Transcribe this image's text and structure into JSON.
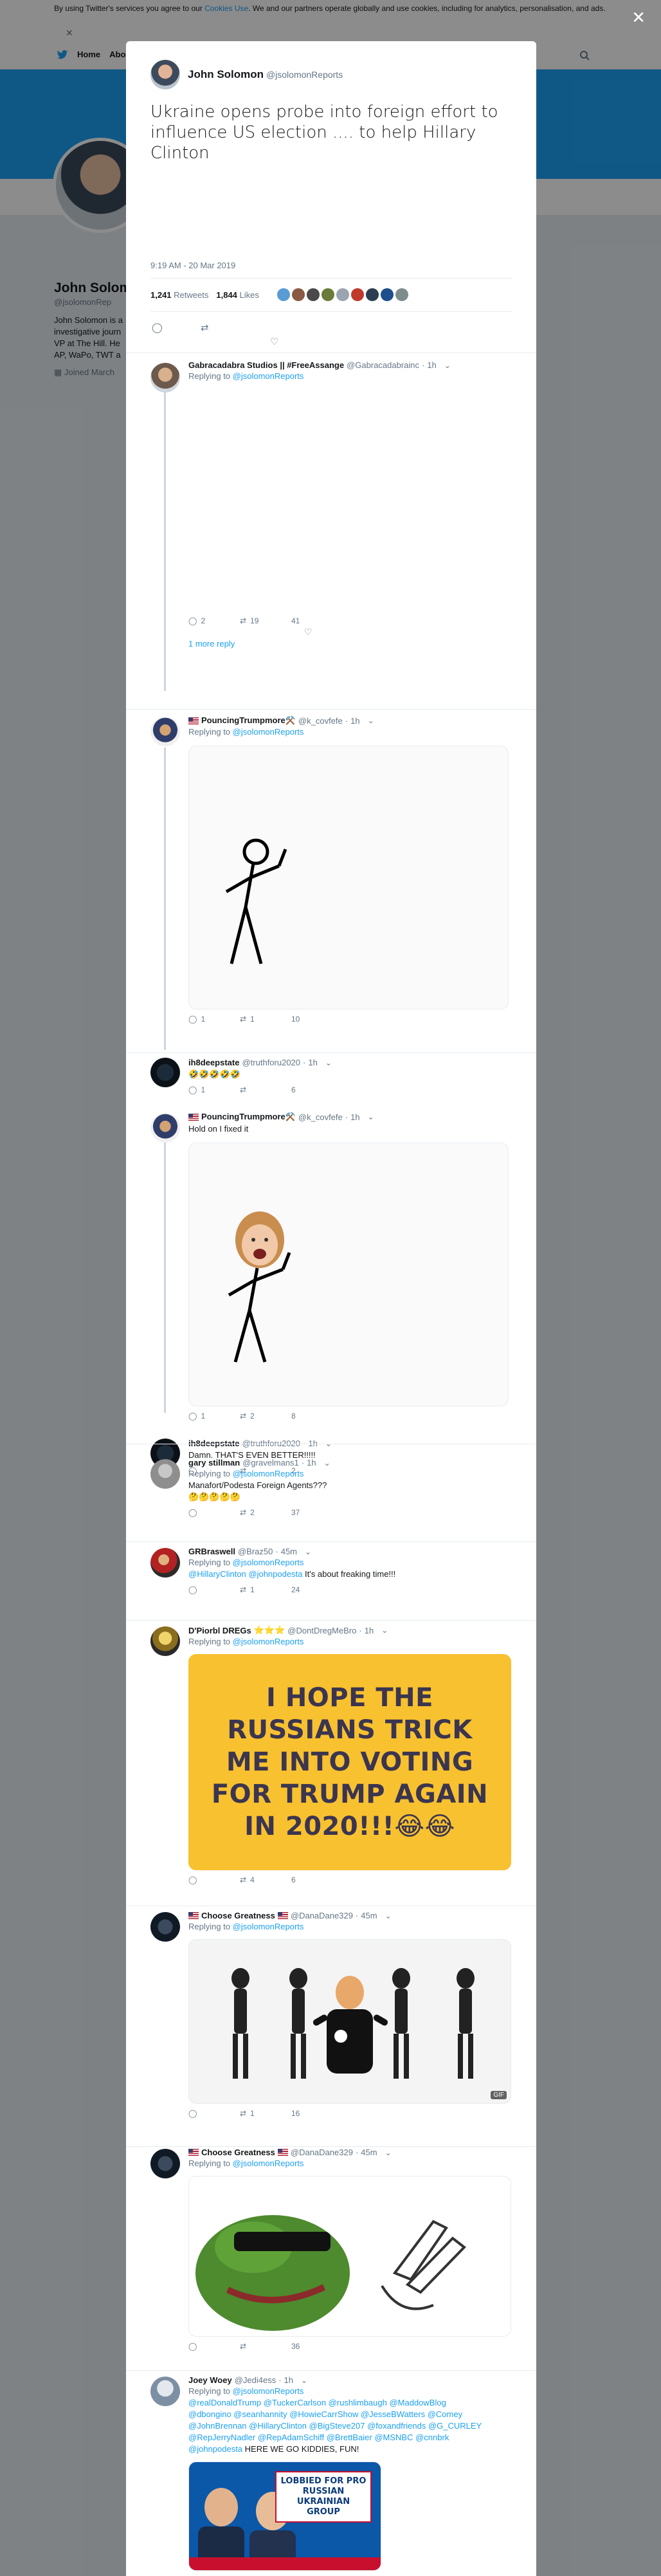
{
  "background": {
    "cookie_text_before": "By using Twitter's services you agree to our ",
    "cookie_link": "Cookies Use",
    "cookie_text_after": ". We and our partners operate globally and use cookies, including for analytics, personalisation, and ads.",
    "nav_home": "Home",
    "nav_about": "Abo",
    "profile_name": "John Solom",
    "profile_handle": "@jsolomonRep",
    "profile_bio": "John Solomon is a\ninvestigative journ\nVP at The Hill. He\nAP, WaPo, TWT a",
    "profile_joined": "Joined March"
  },
  "main_tweet": {
    "name": "John Solomon",
    "handle": "@jsolomonReports",
    "text": "Ukraine opens probe into foreign effort to influence US election .... to help Hillary Clinton",
    "time": "9:19 AM - 20 Mar 2019",
    "retweets_count": "1,241",
    "retweets_label": "Retweets",
    "likes_count": "1,844",
    "likes_label": "Likes"
  },
  "replies": [
    {
      "name": "Gabracadabra Studios || #FreeAssange",
      "handle": "@Gabracadabrainc",
      "time": "1h",
      "replying_prefix": "Replying to",
      "replying_to": "@jsolomonReports",
      "text": "",
      "replies": "2",
      "retweets": "19",
      "likes": "41",
      "more_link": "1 more reply"
    },
    {
      "name": "PouncingTrumpmore⚒️",
      "handle": "@k_covfefe",
      "time": "1h",
      "replying_prefix": "Replying to",
      "replying_to": "@jsolomonReports",
      "text": "",
      "replies": "1",
      "retweets": "1",
      "likes": "10"
    },
    {
      "name": "ih8deepstate",
      "handle": "@truthforu2020",
      "time": "1h",
      "text": "🤣🤣🤣🤣🤣",
      "replies": "1",
      "retweets": "",
      "likes": "6"
    },
    {
      "name": "PouncingTrumpmore⚒️",
      "handle": "@k_covfefe",
      "time": "1h",
      "text": "Hold on I fixed it",
      "replies": "1",
      "retweets": "2",
      "likes": "8"
    },
    {
      "name": "ih8deepstate",
      "handle": "@truthforu2020",
      "time": "1h",
      "text": "Damn. THAT'S EVEN BETTER!!!!!",
      "replies": "",
      "retweets": "",
      "likes": "2"
    },
    {
      "name": "gary stillman",
      "handle": "@gravelmans1",
      "time": "1h",
      "replying_prefix": "Replying to",
      "replying_to": "@jsolomonReports",
      "text": "Manafort/Podesta Foreign Agents???\n🤔🤔🤔🤔🤔",
      "replies": "",
      "retweets": "2",
      "likes": "37"
    },
    {
      "name": "GRBraswell",
      "handle": "@Braz50",
      "time": "45m",
      "replying_prefix": "Replying to",
      "replying_to": "@jsolomonReports",
      "mentions": "@HillaryClinton @johnpodesta",
      "text": " It's about freaking time!!!",
      "replies": "",
      "retweets": "1",
      "likes": "24"
    },
    {
      "name": "D'Piorbl DREGs",
      "stars": "⭐⭐⭐",
      "handle": "@DontDregMeBro",
      "time": "1h",
      "replying_prefix": "Replying to",
      "replying_to": "@jsolomonReports",
      "card_text": "I HOPE THE RUSSIANS TRICK ME INTO VOTING FOR TRUMP AGAIN IN 2020!!!😂😂",
      "replies": "",
      "retweets": "4",
      "likes": "6"
    },
    {
      "name": "Choose Greatness",
      "handle": "@DanaDane329",
      "time": "45m",
      "replying_prefix": "Replying to",
      "replying_to": "@jsolomonReports",
      "gif_label": "GIF",
      "replies": "",
      "retweets": "1",
      "likes": "16"
    },
    {
      "name": "Choose Greatness",
      "handle": "@DanaDane329",
      "time": "45m",
      "replying_prefix": "Replying to",
      "replying_to": "@jsolomonReports",
      "replies": "",
      "retweets": "",
      "likes": "36"
    },
    {
      "name": "Joey Woey",
      "handle": "@Jedi4ess",
      "time": "1h",
      "replying_prefix": "Replying to",
      "replying_to": "@jsolomonReports",
      "mentions": "@realDonaldTrump @TuckerCarlson @rushlimbaugh @MaddowBlog @dbongino @seanhannity @HowieCarrShow @JesseBWatters @Comey @JohnBrennan @HillaryClinton @BigSteve207 @foxandfriends @G_CURLEY @RepJerryNadler @RepAdamSchiff @BrettBaier @MSNBC @cnnbrk @johnpodesta",
      "text": " HERE WE GO KIDDIES, FUN!",
      "news_banner": "LOBBIED FOR PRO RUSSIAN UKRAINIAN GROUP"
    }
  ],
  "colors": {
    "accent": "#1da1f2",
    "banner": "#1da1f2",
    "card_yellow": "#f8c12f",
    "overlay": "rgba(0,0,0,0.45)"
  }
}
